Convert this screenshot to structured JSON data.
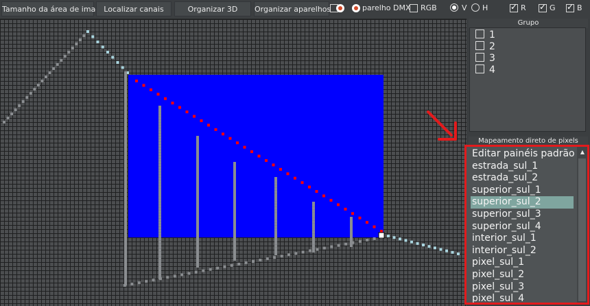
{
  "toolbar": {
    "image_area_size": "Tamanho da área de imagem",
    "locate_channels": "Localizar canais",
    "organize_3d": "Organizar 3D",
    "organize_devices": "Organizar aparelhos",
    "device_dmx_fragment": "parelho DMX",
    "rgb_label": "RGB",
    "v_label": "V",
    "h_label": "H",
    "r_label": "R",
    "g_label": "G",
    "b_label": "B"
  },
  "group": {
    "title": "Grupo",
    "items": [
      "1",
      "2",
      "3",
      "4"
    ]
  },
  "mapping": {
    "title": "Mapeamento direto de pixels",
    "items": [
      "Editar painéis padrão",
      "estrada_sul_1",
      "estrada_sul_2",
      "superior_sul_1",
      "superior_sul_2",
      "superior_sul_3",
      "superior_sul_4",
      "interior_sul_1",
      "interior_sul_2",
      "pixel_sul_1",
      "pixel_sul_2",
      "pixel_sul_3",
      "pixel_sul_4"
    ],
    "selected_index": 4
  },
  "colors": {
    "accent_red": "#e31a1c",
    "selection": "#7fa59f",
    "blue_area": "#0000ff",
    "pixel_red": "#ff0000",
    "pixel_light": "#a9d4de",
    "pixel_gray": "#8a8d90"
  },
  "icons": [
    "checkbox-icon",
    "radio-icon",
    "color-picker-icon",
    "scroll-up-arrow-icon"
  ]
}
